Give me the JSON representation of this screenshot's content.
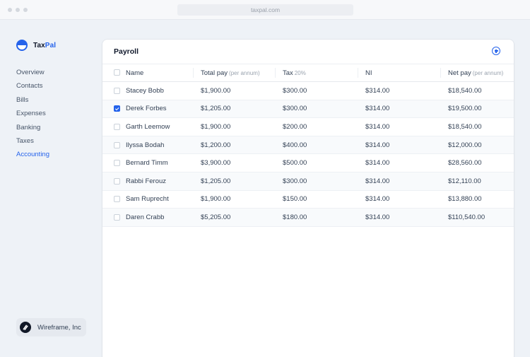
{
  "browser": {
    "url": "taxpal.com"
  },
  "brand": {
    "name_part1": "Tax",
    "name_part2": "Pal",
    "accent": "#2563eb"
  },
  "sidebar": {
    "items": [
      {
        "label": "Overview",
        "active": false
      },
      {
        "label": "Contacts",
        "active": false
      },
      {
        "label": "Bills",
        "active": false
      },
      {
        "label": "Expenses",
        "active": false
      },
      {
        "label": "Banking",
        "active": false
      },
      {
        "label": "Taxes",
        "active": false
      },
      {
        "label": "Accounting",
        "active": true
      }
    ],
    "org": {
      "name": "Wireframe, Inc",
      "icon": "slash-logo-icon"
    }
  },
  "panel": {
    "title": "Payroll",
    "add_icon": "plus-circle-icon",
    "columns": {
      "name": "Name",
      "total": "Total pay",
      "total_sub": "(per annum)",
      "tax": "Tax",
      "tax_sub": "20%",
      "ni": "NI",
      "net": "Net pay",
      "net_sub": "(per annum)"
    },
    "rows": [
      {
        "name": "Stacey Bobb",
        "total": "$1,900.00",
        "tax": "$300.00",
        "ni": "$314.00",
        "net": "$18,540.00",
        "checked": false
      },
      {
        "name": "Derek Forbes",
        "total": "$1,205.00",
        "tax": "$300.00",
        "ni": "$314.00",
        "net": "$19,500.00",
        "checked": true
      },
      {
        "name": "Garth Leemow",
        "total": "$1,900.00",
        "tax": "$200.00",
        "ni": "$314.00",
        "net": "$18,540.00",
        "checked": false
      },
      {
        "name": "Ilyssa Bodah",
        "total": "$1,200.00",
        "tax": "$400.00",
        "ni": "$314.00",
        "net": "$12,000.00",
        "checked": false
      },
      {
        "name": "Bernard Timm",
        "total": "$3,900.00",
        "tax": "$500.00",
        "ni": "$314.00",
        "net": "$28,560.00",
        "checked": false
      },
      {
        "name": "Rabbi Ferouz",
        "total": "$1,205.00",
        "tax": "$300.00",
        "ni": "$314.00",
        "net": "$12,110.00",
        "checked": false
      },
      {
        "name": "Sam Ruprecht",
        "total": "$1,900.00",
        "tax": "$150.00",
        "ni": "$314.00",
        "net": "$13,880.00",
        "checked": false
      },
      {
        "name": "Daren Crabb",
        "total": "$5,205.00",
        "tax": "$180.00",
        "ni": "$314.00",
        "net": "$110,540.00",
        "checked": false
      }
    ]
  }
}
